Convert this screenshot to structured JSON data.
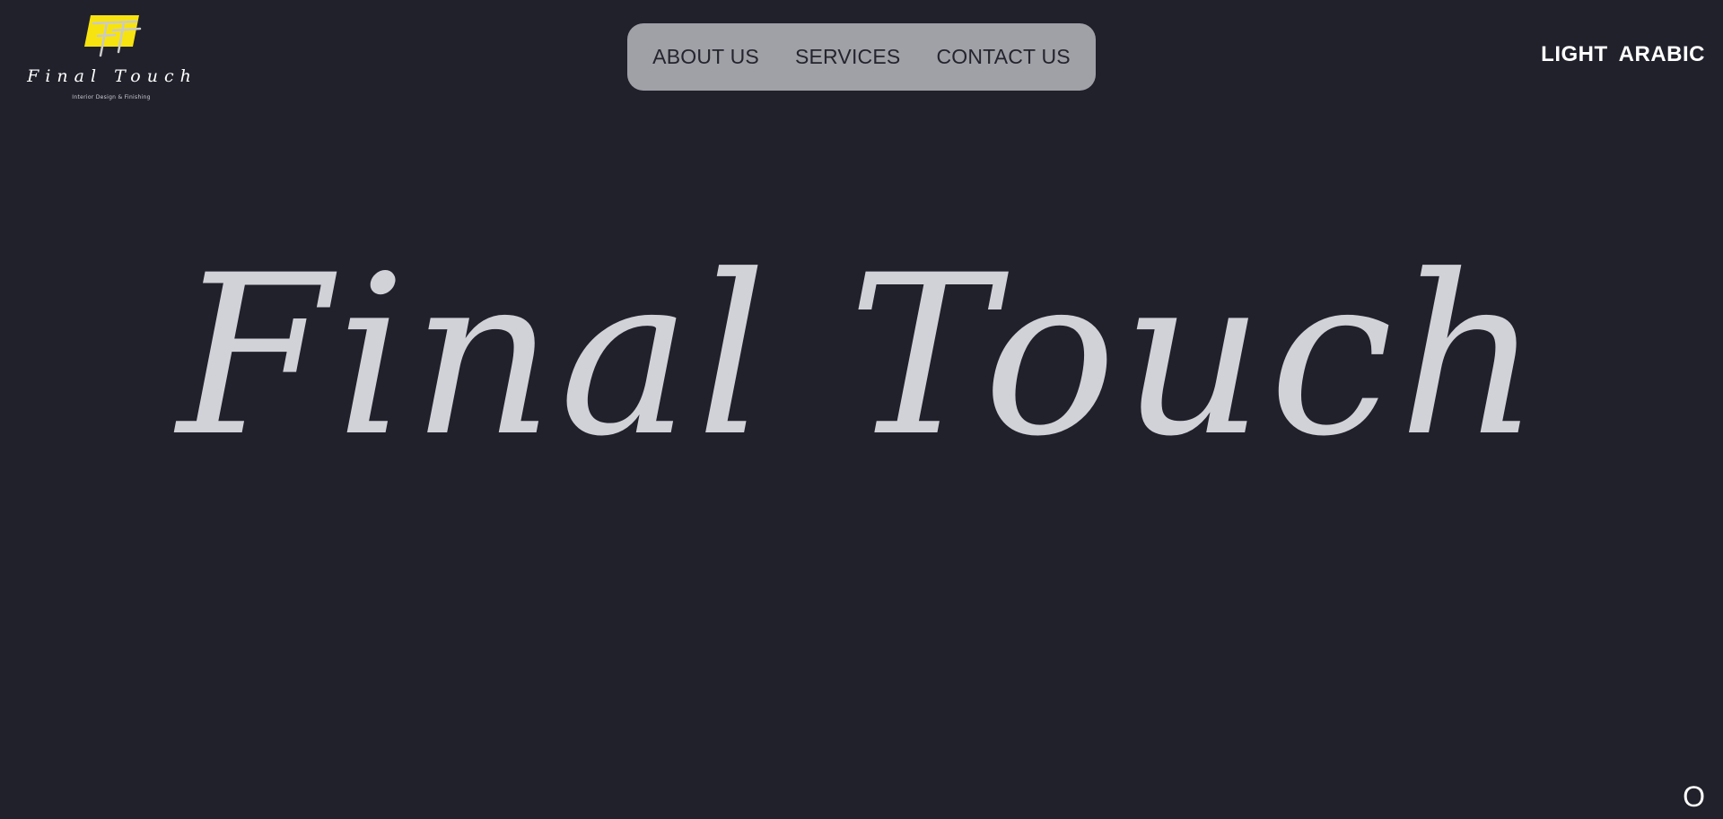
{
  "logo": {
    "script_text": "Final Touch",
    "tagline": "Interior Design & Finishing",
    "monogram": "FT",
    "accent_color": "#f7e30f"
  },
  "nav": {
    "items": [
      {
        "label": "ABOUT US"
      },
      {
        "label": "SERVICES"
      },
      {
        "label": "CONTACT US"
      }
    ]
  },
  "actions": {
    "light_label": "LIGHT",
    "arabic_label": "ARABIC"
  },
  "hero": {
    "title": "Final Touch"
  },
  "corner": {
    "label": "O"
  },
  "colors": {
    "background": "#21212c",
    "nav_background": "#a0a1a7",
    "hero_text": "#d1d1d8"
  }
}
